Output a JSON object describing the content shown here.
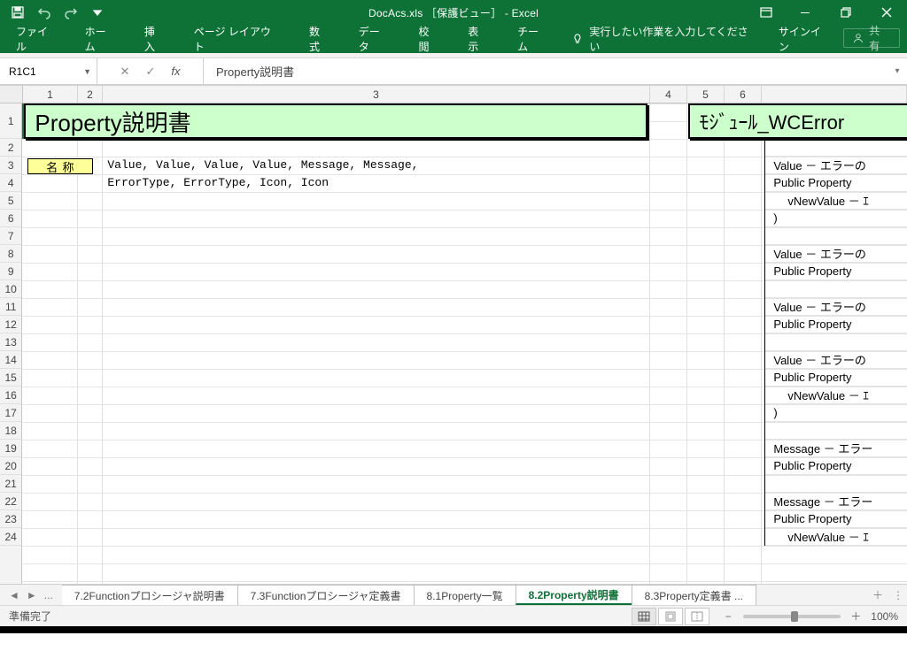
{
  "window": {
    "title": "DocAcs.xls ［保護ビュー］ - Excel"
  },
  "qat": {
    "save_icon": "save-icon",
    "undo_icon": "undo-icon",
    "redo_icon": "redo-icon",
    "customize_icon": "chevron-down-icon"
  },
  "win": {
    "ribbon_opts_label": "リボン表示オプション",
    "minimize_label": "最小化",
    "restore_label": "元に戻す",
    "close_label": "閉じる"
  },
  "ribbon": {
    "file": "ファイル",
    "home": "ホーム",
    "insert": "挿入",
    "layout": "ページ レイアウト",
    "formulas": "数式",
    "data": "データ",
    "review": "校閲",
    "view": "表示",
    "team": "チーム",
    "tellme": "実行したい作業を入力してください",
    "signin": "サインイン",
    "share": "共有"
  },
  "fx": {
    "namebox": "R1C1",
    "cancel": "✕",
    "enter": "✓",
    "fx": "fx",
    "formula": "Property説明書"
  },
  "colheads": {
    "c1": "1",
    "c2": "2",
    "c3": "3",
    "c4": "4",
    "c5": "5",
    "c6": "6"
  },
  "rowheads": [
    "1",
    "2",
    "3",
    "4",
    "5",
    "6",
    "7",
    "8",
    "9",
    "10",
    "11",
    "12",
    "13",
    "14",
    "15",
    "16",
    "17",
    "18",
    "19",
    "20",
    "21",
    "22",
    "23",
    "24"
  ],
  "sheet": {
    "title": "Property説明書",
    "module_title": "ﾓｼﾞｭｰﾙ_WCError",
    "field_label": "名 称",
    "line3": "Value, Value, Value, Value, Message, Message,",
    "line4": "ErrorType, ErrorType, Icon, Icon",
    "right": [
      "",
      "Value － エラーの",
      "Public Property",
      "  vNewValue  － ｴ",
      " )",
      "",
      "Value － エラーの",
      "Public Property",
      "",
      "Value － エラーの",
      "Public Property",
      "",
      "Value － エラーの",
      "Public Property",
      "  vNewValue  － ｴ",
      " )",
      "",
      "Message － エラー",
      "Public Property",
      "",
      "Message － エラー",
      "Public Property",
      "  vNewValue  － ｴ"
    ]
  },
  "tabs": {
    "ellipsis": "...",
    "t1": "7.2Functionプロシージャ説明書",
    "t2": "7.3Functionプロシージャ定義書",
    "t3": "8.1Property一覧",
    "t4": "8.2Property説明書",
    "t5": "8.3Property定義書 ...",
    "add": "＋"
  },
  "status": {
    "ready": "準備完了",
    "zoom": "100%",
    "minus": "−",
    "plus": "＋"
  }
}
